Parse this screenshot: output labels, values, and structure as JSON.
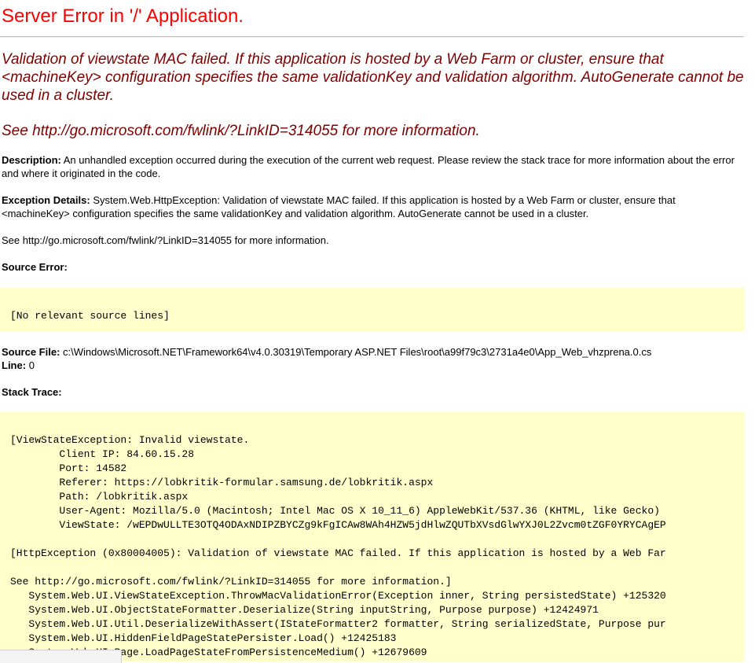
{
  "page": {
    "title": "Server Error in '/' Application.",
    "heading_message": "Validation of viewstate MAC failed. If this application is hosted by a Web Farm or cluster, ensure that <machineKey> configuration specifies the same validationKey and validation algorithm. AutoGenerate cannot be used in a cluster.",
    "heading_link": "See http://go.microsoft.com/fwlink/?LinkID=314055 for more information."
  },
  "description": {
    "label": "Description:",
    "text": "An unhandled exception occurred during the execution of the current web request. Please review the stack trace for more information about the error and where it originated in the code."
  },
  "exception_details": {
    "label": "Exception Details:",
    "text": "System.Web.HttpException: Validation of viewstate MAC failed. If this application is hosted by a Web Farm or cluster, ensure that <machineKey> configuration specifies the same validationKey and validation algorithm. AutoGenerate cannot be used in a cluster."
  },
  "see_more": "See http://go.microsoft.com/fwlink/?LinkID=314055 for more information.",
  "source_error": {
    "label": "Source Error:",
    "code": "[No relevant source lines]"
  },
  "source_file": {
    "label": "Source File:",
    "path": "c:\\Windows\\Microsoft.NET\\Framework64\\v4.0.30319\\Temporary ASP.NET Files\\root\\a99f79c3\\2731a4e0\\App_Web_vhzprena.0.cs",
    "line_label": "Line:",
    "line_value": "0"
  },
  "stack_trace": {
    "label": "Stack Trace:",
    "lines": [
      "[ViewStateException: Invalid viewstate.",
      "        Client IP: 84.60.15.28",
      "        Port: 14582",
      "        Referer: https://lobkritik-formular.samsung.de/lobkritik.aspx",
      "        Path: /lobkritik.aspx",
      "        User-Agent: Mozilla/5.0 (Macintosh; Intel Mac OS X 10_11_6) AppleWebKit/537.36 (KHTML, like Gecko)",
      "        ViewState: /wEPDwULLTE3OTQ4ODAxNDIPZBYCZg9kFgICAw8WAh4HZW5jdHlwZQUTbXVsdGlwYXJ0L2Zvcm0tZGF0YRYCAgEP",
      "",
      "[HttpException (0x80004005): Validation of viewstate MAC failed. If this application is hosted by a Web Far",
      "",
      "See http://go.microsoft.com/fwlink/?LinkID=314055 for more information.]",
      "   System.Web.UI.ViewStateException.ThrowMacValidationError(Exception inner, String persistedState) +125320",
      "   System.Web.UI.ObjectStateFormatter.Deserialize(String inputString, Purpose purpose) +12424971",
      "   System.Web.UI.Util.DeserializeWithAssert(IStateFormatter2 formatter, String serializedState, Purpose pur",
      "   System.Web.UI.HiddenFieldPageStatePersister.Load() +12425183",
      "   System.Web.UI.Page.LoadPageStateFromPersistenceMedium() +12679609"
    ]
  }
}
